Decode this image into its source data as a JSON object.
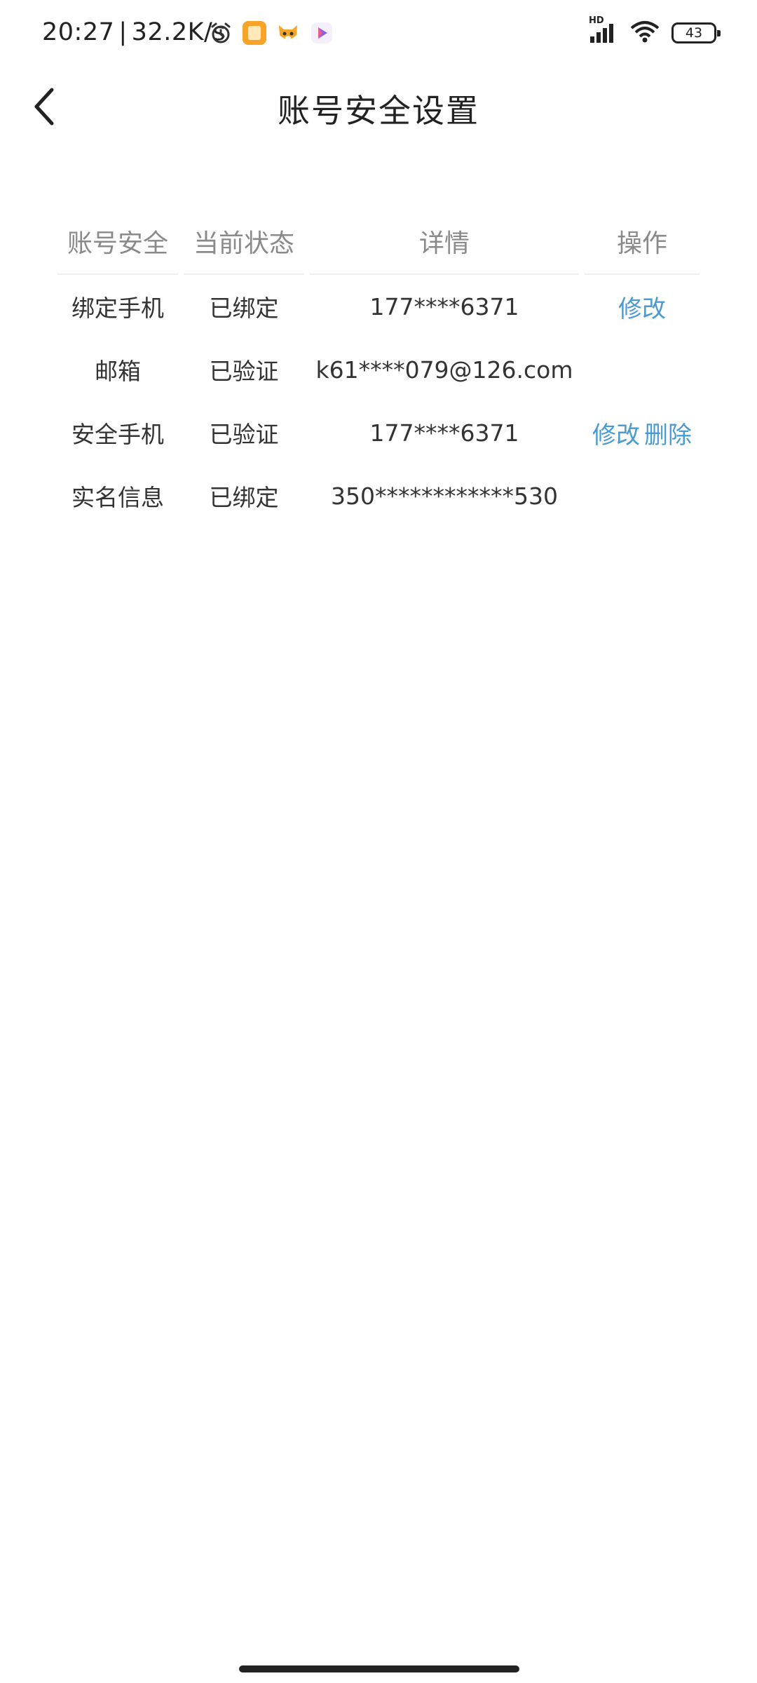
{
  "status_bar": {
    "time": "20:27",
    "separator": "|",
    "speed": "32.2K/s",
    "battery_level": "43",
    "network_label": "HD",
    "icons": [
      "alarm-icon",
      "notes-app-icon",
      "fox-app-icon",
      "video-app-icon",
      "signal-icon",
      "wifi-icon",
      "battery-icon"
    ]
  },
  "header": {
    "title": "账号安全设置",
    "back_icon": "chevron-left-icon"
  },
  "table": {
    "headers": [
      "账号安全",
      "当前状态",
      "详情",
      "操作"
    ],
    "rows": [
      {
        "type": "绑定手机",
        "status": "已绑定",
        "detail": "177****6371",
        "actions": [
          "修改"
        ]
      },
      {
        "type": "邮箱",
        "status": "已验证",
        "detail": "k61****079@126.com",
        "actions": []
      },
      {
        "type": "安全手机",
        "status": "已验证",
        "detail": "177****6371",
        "actions": [
          "修改",
          "删除"
        ]
      },
      {
        "type": "实名信息",
        "status": "已绑定",
        "detail": "350************530",
        "actions": []
      }
    ]
  },
  "colors": {
    "link": "#4a9bd1",
    "header_text": "#8a8a8a",
    "body_text": "#333333",
    "divider": "#efefef"
  }
}
